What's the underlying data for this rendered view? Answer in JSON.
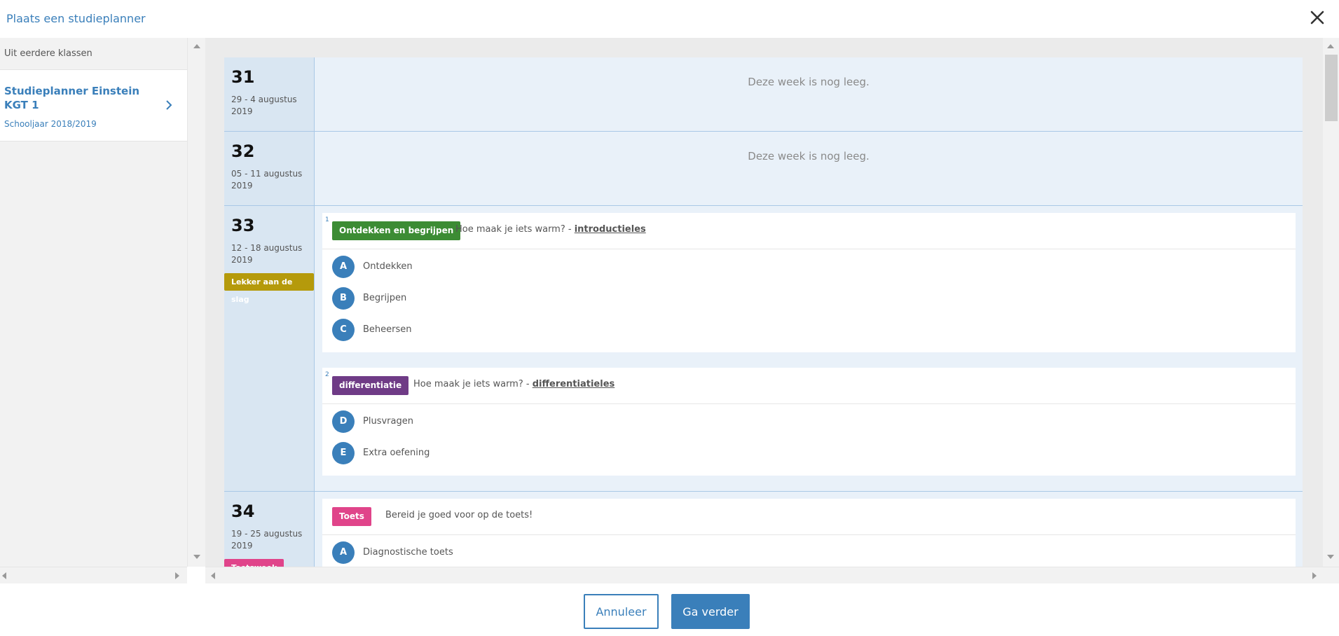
{
  "modal": {
    "title": "Plaats een studieplanner"
  },
  "left": {
    "header": "Uit eerdere klassen",
    "item_title": "Studieplanner Einstein KGT 1",
    "item_sub": "Schooljaar 2018/2019"
  },
  "weeks": [
    {
      "num": "31",
      "dates": "29 - 4 augustus 2019",
      "empty": "Deze week is nog leeg."
    },
    {
      "num": "32",
      "dates": "05 - 11 augustus 2019",
      "empty": "Deze week is nog leeg."
    },
    {
      "num": "33",
      "dates": "12 - 18 augustus 2019",
      "badge": "Lekker aan de slag",
      "lessons": [
        {
          "index": "1",
          "tag": "Ontdekken en begrijpen",
          "desc": "Hoe maak je iets warm? - ",
          "link": "introductieles",
          "steps": [
            {
              "letter": "A",
              "label": "Ontdekken"
            },
            {
              "letter": "B",
              "label": "Begrijpen"
            },
            {
              "letter": "C",
              "label": "Beheersen"
            }
          ]
        },
        {
          "index": "2",
          "tag": "differentiatie",
          "desc": "Hoe maak je iets warm? - ",
          "link": "differentiatieles",
          "steps": [
            {
              "letter": "D",
              "label": "Plusvragen"
            },
            {
              "letter": "E",
              "label": "Extra oefening"
            }
          ]
        }
      ]
    },
    {
      "num": "34",
      "dates": "19 - 25 augustus 2019",
      "badge": "Toetsweek",
      "lessons": [
        {
          "tag": "Toets",
          "desc": "Bereid je goed voor op de toets!",
          "steps": [
            {
              "letter": "A",
              "label": "Diagnostische toets"
            }
          ]
        }
      ]
    }
  ],
  "footer": {
    "cancel": "Annuleer",
    "next": "Ga verder"
  },
  "colors": {
    "accent": "#3a7fba",
    "tag_green": "#3c8c34",
    "tag_purple": "#6f3b86",
    "tag_pink": "#e0448a",
    "badge_gold": "#b59a0b"
  }
}
